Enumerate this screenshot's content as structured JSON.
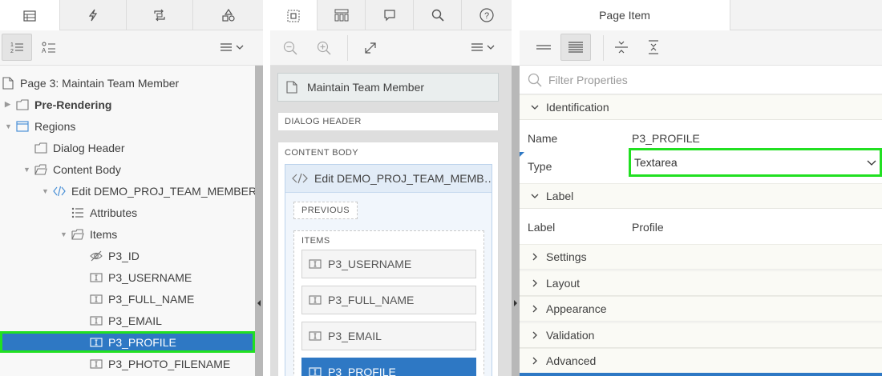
{
  "left_pane": {
    "tabs": [
      {
        "icon": "rendering-tree-icon"
      },
      {
        "icon": "dynamic-actions-icon"
      },
      {
        "icon": "processing-icon"
      },
      {
        "icon": "shared-components-icon"
      }
    ],
    "tree": [
      {
        "label": "Page 3: Maintain Team Member",
        "icon": "page-icon",
        "toggle": ""
      },
      {
        "label": "Pre-Rendering",
        "icon": "folder-icon",
        "toggle": "▶"
      },
      {
        "label": "Regions",
        "icon": "region-icon",
        "toggle": "▼"
      },
      {
        "label": "Dialog Header",
        "icon": "folder-icon",
        "toggle": ""
      },
      {
        "label": "Content Body",
        "icon": "folder-open-icon",
        "toggle": "▼"
      },
      {
        "label": "Edit DEMO_PROJ_TEAM_MEMBERS",
        "icon": "code-icon",
        "toggle": "▼"
      },
      {
        "label": "Attributes",
        "icon": "attributes-icon",
        "toggle": ""
      },
      {
        "label": "Items",
        "icon": "folder-open-icon",
        "toggle": "▼"
      },
      {
        "label": "P3_ID",
        "icon": "hidden-icon",
        "toggle": ""
      },
      {
        "label": "P3_USERNAME",
        "icon": "text-field-icon",
        "toggle": ""
      },
      {
        "label": "P3_FULL_NAME",
        "icon": "text-field-icon",
        "toggle": ""
      },
      {
        "label": "P3_EMAIL",
        "icon": "text-field-icon",
        "toggle": ""
      },
      {
        "label": "P3_PROFILE",
        "icon": "text-field-icon",
        "toggle": ""
      },
      {
        "label": "P3_PHOTO_FILENAME",
        "icon": "text-field-icon",
        "toggle": ""
      }
    ]
  },
  "middle_pane": {
    "page_title": "Maintain Team Member",
    "dialog_header": "DIALOG HEADER",
    "content_body": "CONTENT BODY",
    "region_title": "Edit DEMO_PROJ_TEAM_MEMB…",
    "previous_label": "PREVIOUS",
    "items_label": "ITEMS",
    "items": [
      "P3_USERNAME",
      "P3_FULL_NAME",
      "P3_EMAIL",
      "P3_PROFILE"
    ]
  },
  "right_pane": {
    "tab_label": "Page Item",
    "filter_placeholder": "Filter Properties",
    "groups": {
      "identification": "Identification",
      "label": "Label",
      "settings": "Settings",
      "layout": "Layout",
      "appearance": "Appearance",
      "validation": "Validation",
      "advanced": "Advanced"
    },
    "properties": {
      "name_label": "Name",
      "name_value": "P3_PROFILE",
      "type_label": "Type",
      "type_value": "Textarea",
      "label_label": "Label",
      "label_value": "Profile"
    }
  },
  "colors": {
    "selection": "#2e78c4",
    "highlight": "#21e021"
  }
}
